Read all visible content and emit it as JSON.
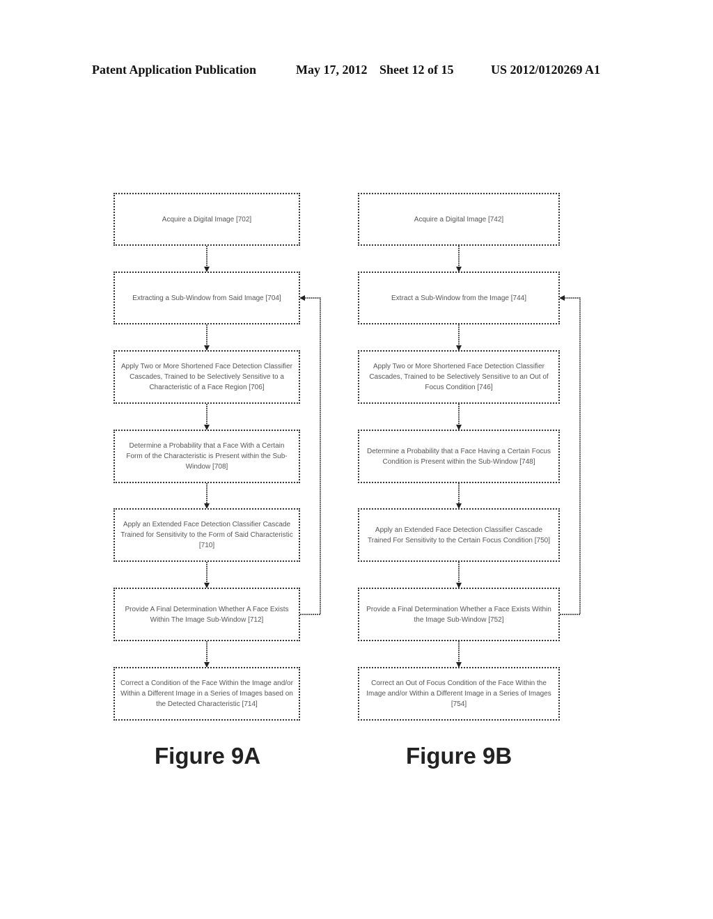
{
  "header": {
    "publication": "Patent Application Publication",
    "date": "May 17, 2012",
    "sheet": "Sheet 12 of 15",
    "number": "US 2012/0120269 A1"
  },
  "figure_a": {
    "label": "Figure 9A",
    "steps": [
      "Acquire a Digital Image [702]",
      "Extracting a Sub-Window from Said Image [704]",
      "Apply Two or More Shortened Face Detection Classifier Cascades, Trained to be Selectively Sensitive to a Characteristic of a Face Region [706]",
      "Determine a Probability that a Face With a Certain Form of the Characteristic is Present within the Sub-Window [708]",
      "Apply an Extended Face Detection Classifier Cascade Trained for Sensitivity to the Form of Said Characteristic [710]",
      "Provide A Final Determination Whether A Face Exists Within The Image Sub-Window [712]",
      "Correct a Condition of the Face Within the Image and/or Within a Different Image in a Series of Images based on the Detected Characteristic [714]"
    ],
    "loop": {
      "from_step": 6,
      "to_step": 2
    }
  },
  "figure_b": {
    "label": "Figure 9B",
    "steps": [
      "Acquire a Digital Image [742]",
      "Extract a Sub-Window from the Image [744]",
      "Apply Two or More Shortened Face Detection Classifier Cascades, Trained to be Selectively Sensitive to an Out of Focus Condition [746]",
      "Determine a Probability that a Face Having a Certain Focus Condition is Present within the Sub-Window [748]",
      "Apply an Extended Face Detection Classifier Cascade Trained For Sensitivity to the Certain Focus Condition [750]",
      "Provide a Final Determination Whether a Face Exists Within the Image Sub-Window [752]",
      "Correct an Out of Focus Condition of the Face Within the Image and/or Within a Different Image in a Series of Images [754]"
    ],
    "loop": {
      "from_step": 6,
      "to_step": 2
    }
  }
}
